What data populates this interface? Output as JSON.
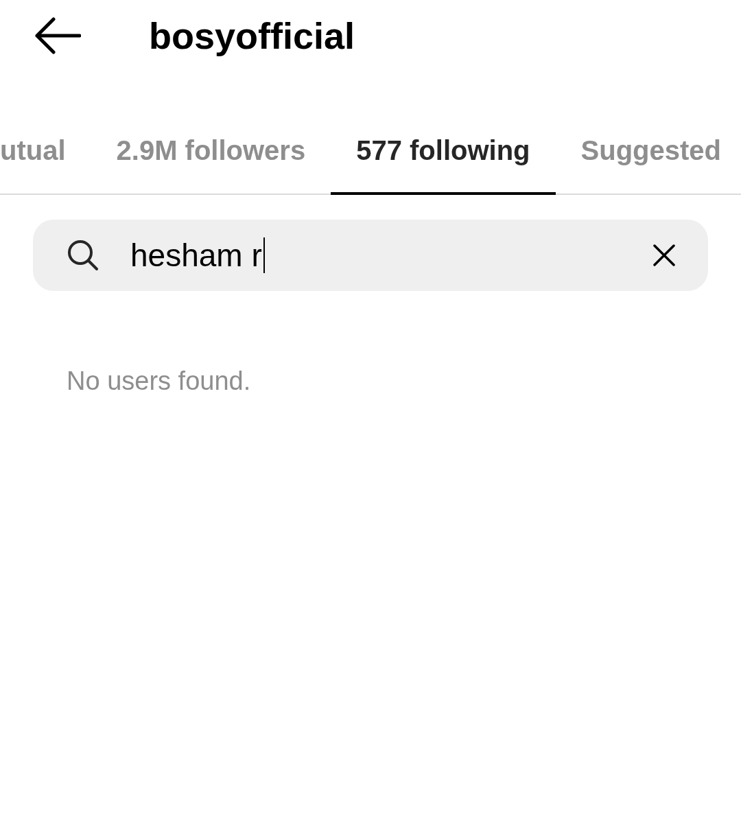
{
  "header": {
    "title": "bosyofficial"
  },
  "tabs": [
    {
      "label": "utual",
      "selected": false
    },
    {
      "label": "2.9M followers",
      "selected": false
    },
    {
      "label": "577 following",
      "selected": true
    },
    {
      "label": "Suggested",
      "selected": false
    }
  ],
  "search": {
    "value": "hesham r",
    "focused": true
  },
  "empty_message": "No users found."
}
